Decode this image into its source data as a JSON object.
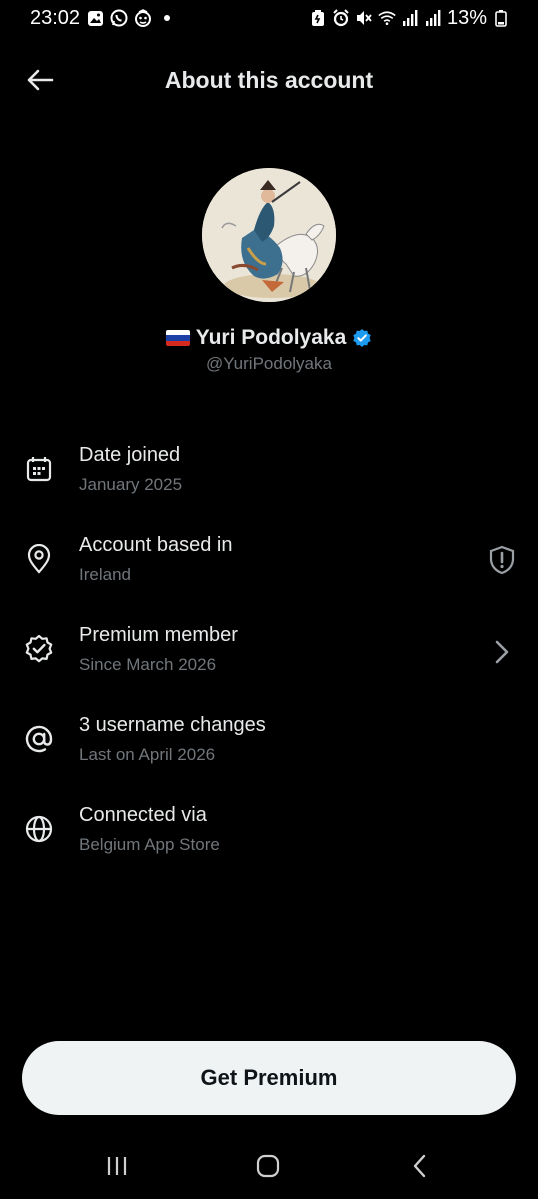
{
  "status_bar": {
    "time": "23:02",
    "battery": "13%"
  },
  "header": {
    "title": "About this account"
  },
  "profile": {
    "name": "Yuri Podolyaka",
    "handle": "@YuriPodolyaka",
    "flag_colors": [
      "#ffffff",
      "#1c3fa8",
      "#d52b1e"
    ],
    "verified_color": "#1d9bf0"
  },
  "info": [
    {
      "title": "Date joined",
      "subtitle": "January 2025",
      "icon": "calendar-icon"
    },
    {
      "title": "Account based in",
      "subtitle": "Ireland",
      "icon": "location-pin-icon"
    },
    {
      "title": "Premium member",
      "subtitle": "Since March 2026",
      "icon": "verified-badge-icon"
    },
    {
      "title": "3 username changes",
      "subtitle": "Last on April 2026",
      "icon": "at-sign-icon"
    },
    {
      "title": "Connected via",
      "subtitle": "Belgium App Store",
      "icon": "globe-icon"
    }
  ],
  "actions": {
    "premium_button": "Get Premium"
  }
}
